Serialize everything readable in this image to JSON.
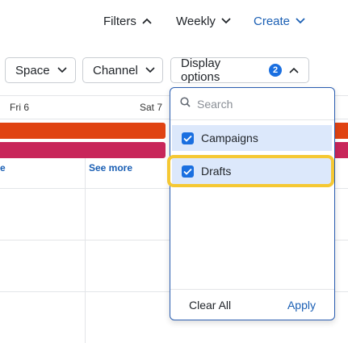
{
  "topbar": {
    "filters_label": "Filters",
    "weekly_label": "Weekly",
    "create_label": "Create"
  },
  "filterbar": {
    "space_label": "Space",
    "channel_label": "Channel",
    "display_label": "Display options",
    "display_count": "2"
  },
  "calendar": {
    "day1": "Fri 6",
    "day2": "Sat 7",
    "see_more_left": "e",
    "see_more": "See more"
  },
  "dropdown": {
    "search_placeholder": "Search",
    "options": [
      {
        "label": "Campaigns",
        "checked": true
      },
      {
        "label": "Drafts",
        "checked": true
      }
    ],
    "clear_label": "Clear All",
    "apply_label": "Apply"
  },
  "colors": {
    "accent": "#1a5fb4",
    "checkbox": "#1a6fe0",
    "bar_orange": "#e04312",
    "bar_pink": "#c8265a",
    "highlight": "#f5c833"
  }
}
